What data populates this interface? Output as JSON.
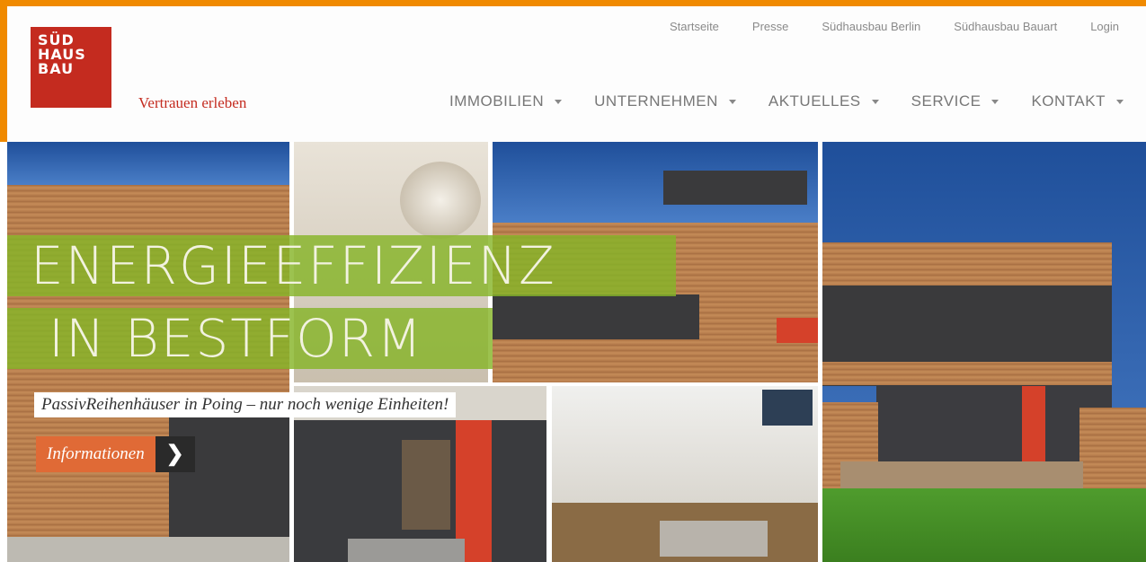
{
  "brand": {
    "logo_lines": [
      "SÜD",
      "HAUS",
      "BAU"
    ],
    "tagline": "Vertrauen erleben",
    "accent": "#f08a00",
    "logo_color": "#c42b1f"
  },
  "topnav": [
    "Startseite",
    "Presse",
    "Südhausbau Berlin",
    "Südhausbau Bauart",
    "Login"
  ],
  "mainnav": [
    {
      "label": "IMMOBILIEN"
    },
    {
      "label": "UNTERNEHMEN"
    },
    {
      "label": "AKTUELLES"
    },
    {
      "label": "SERVICE"
    },
    {
      "label": "KONTAKT"
    }
  ],
  "hero": {
    "headline_1": "ENERGIEEFFIZIENZ",
    "headline_2": "IN BESTFORM",
    "subline": "PassivReihenhäuser in Poing – nur noch wenige Einheiten!",
    "cta_label": "Informationen",
    "cta_icon": "chevron-right-icon",
    "headline_bg": "#86b428",
    "cta_color": "#e06a36"
  }
}
